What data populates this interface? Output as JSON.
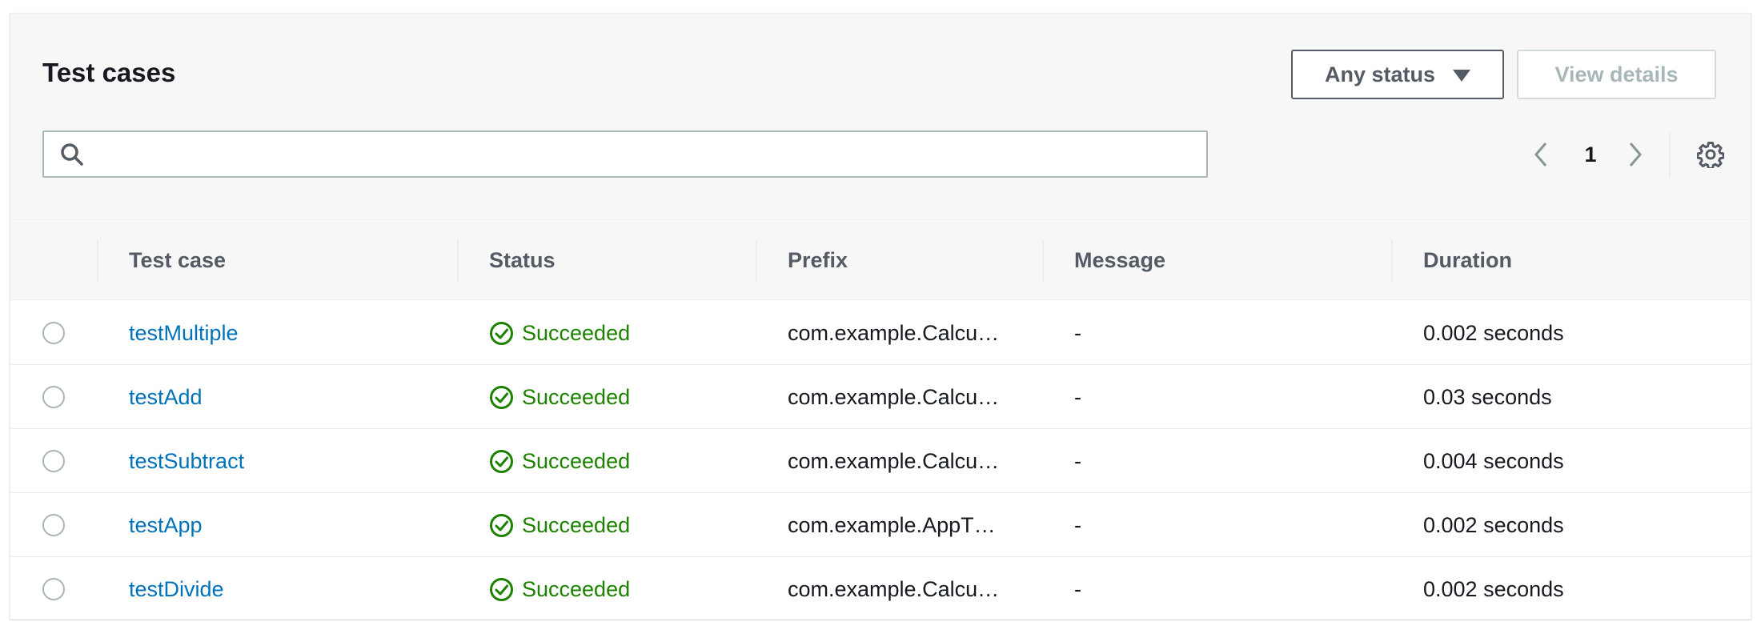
{
  "header": {
    "title": "Test cases",
    "status_filter_label": "Any status",
    "view_details_label": "View details"
  },
  "search": {
    "value": "",
    "placeholder": ""
  },
  "pagination": {
    "current_page": "1"
  },
  "table": {
    "columns": [
      "Test case",
      "Status",
      "Prefix",
      "Message",
      "Duration"
    ],
    "rows": [
      {
        "test_case": "testMultiple",
        "status": "Succeeded",
        "prefix": "com.example.Calcu…",
        "message": "-",
        "duration": "0.002 seconds"
      },
      {
        "test_case": "testAdd",
        "status": "Succeeded",
        "prefix": "com.example.Calcu…",
        "message": "-",
        "duration": "0.03 seconds"
      },
      {
        "test_case": "testSubtract",
        "status": "Succeeded",
        "prefix": "com.example.Calcu…",
        "message": "-",
        "duration": "0.004 seconds"
      },
      {
        "test_case": "testApp",
        "status": "Succeeded",
        "prefix": "com.example.AppT…",
        "message": "-",
        "duration": "0.002 seconds"
      },
      {
        "test_case": "testDivide",
        "status": "Succeeded",
        "prefix": "com.example.Calcu…",
        "message": "-",
        "duration": "0.002 seconds"
      }
    ]
  },
  "colors": {
    "link": "#0073bb",
    "success": "#1d8102",
    "header_bg": "#f7f7f7",
    "border": "#eaeded"
  },
  "icons": [
    "search-icon",
    "chevron-left-icon",
    "chevron-right-icon",
    "gear-icon",
    "check-circle-icon",
    "caret-down-icon"
  ]
}
